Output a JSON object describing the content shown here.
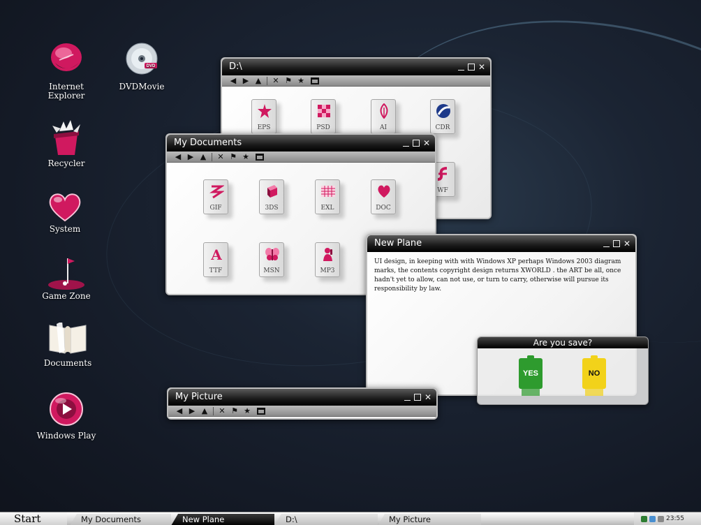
{
  "desktop": {
    "icons": [
      {
        "label": "Internet Explorer",
        "icon": "internet-explorer-icon"
      },
      {
        "label": "DVDMovie",
        "icon": "dvd-icon"
      },
      {
        "label": "Recycler",
        "icon": "recycler-icon"
      },
      {
        "label": "System",
        "icon": "heart-icon"
      },
      {
        "label": "Game Zone",
        "icon": "golf-flag-icon"
      },
      {
        "label": "Documents",
        "icon": "open-book-icon"
      },
      {
        "label": "Windows Play",
        "icon": "play-icon"
      }
    ],
    "dvd_badge": "DVD"
  },
  "windows": {
    "d_drive": {
      "title": "D:\\",
      "files": [
        {
          "ext": "EPS"
        },
        {
          "ext": "PSD"
        },
        {
          "ext": "AI"
        },
        {
          "ext": "CDR"
        },
        {
          "ext": "WF"
        }
      ]
    },
    "my_documents": {
      "title": "My Documents",
      "files": [
        {
          "ext": "GIF"
        },
        {
          "ext": "3DS"
        },
        {
          "ext": "EXL"
        },
        {
          "ext": "DOC"
        },
        {
          "ext": "TTF"
        },
        {
          "ext": "MSN"
        },
        {
          "ext": "MP3"
        }
      ]
    },
    "new_plane": {
      "title": "New Plane",
      "text": "UI design, in keeping with with Windows XP perhaps Windows 2003 diagram marks, the contents copyright design returns XWORLD . the ART be all, once hadn't yet to  allow, can not use, or turn to carry, otherwise will pursue its responsibility by law."
    },
    "my_picture": {
      "title": "My Picture"
    }
  },
  "dialog": {
    "title": "Are you save?",
    "yes_label": "YES",
    "no_label": "NO",
    "yes_color": "#2e9b2e",
    "no_color": "#f2d21a"
  },
  "taskbar": {
    "start_label": "Start",
    "tasks": [
      "My Documents",
      "New Plane",
      "D:\\",
      "My Picture"
    ],
    "clock": "23:55"
  },
  "theme": {
    "accent": "#d0195f",
    "titlebar": "#000000"
  }
}
